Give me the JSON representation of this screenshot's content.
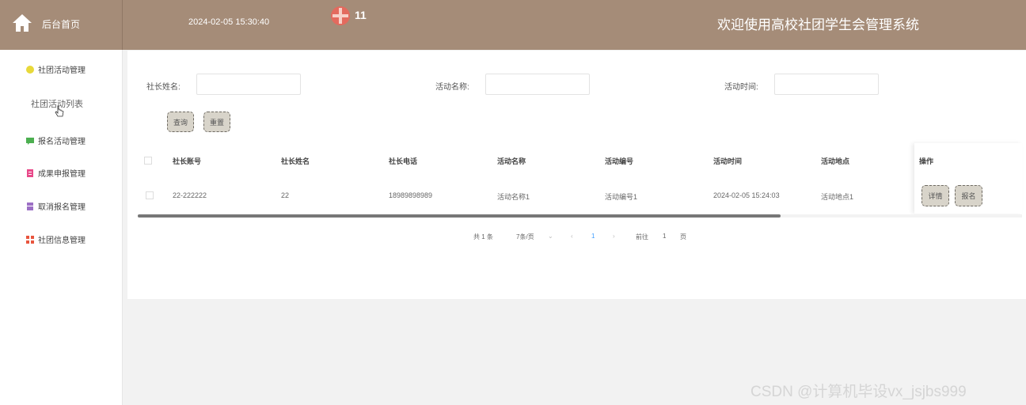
{
  "header": {
    "home_label": "后台首页",
    "datetime": "2024-02-05 15:30:40",
    "badge_count": "11",
    "title": "欢迎使用高校社团学生会管理系统",
    "home_icon": "home-icon",
    "avatar_icon": "avatar-icon"
  },
  "sidebar": {
    "items": [
      {
        "label": "社团活动管理",
        "icon": "circle-icon",
        "color": "#e8d93a"
      },
      {
        "label": "社团活动列表"
      },
      {
        "label": "报名活动管理",
        "icon": "message-icon",
        "color": "#4caf50"
      },
      {
        "label": "成果申报管理",
        "icon": "document-icon",
        "color": "#e84a8a"
      },
      {
        "label": "取消报名管理",
        "icon": "folder-icon",
        "color": "#9c6fc5"
      },
      {
        "label": "社团信息管理",
        "icon": "grid-icon",
        "color": "#e8553e"
      }
    ]
  },
  "filters": {
    "president_name_label": "社长姓名:",
    "activity_name_label": "活动名称:",
    "activity_time_label": "活动时间:",
    "search_button": "查询",
    "reset_button": "重置"
  },
  "table": {
    "columns": [
      "社长账号",
      "社长姓名",
      "社长电话",
      "活动名称",
      "活动编号",
      "活动时间",
      "活动地点",
      "操作"
    ],
    "rows": [
      {
        "account": "22-222222",
        "name": "22",
        "phone": "18989898989",
        "activity_name": "活动名称1",
        "activity_no": "活动编号1",
        "activity_time": "2024-02-05 15:24:03",
        "activity_place": "活动地点1",
        "detail_button": "详情",
        "signup_button": "报名"
      }
    ]
  },
  "pagination": {
    "total": "共 1 条",
    "page_size": "7条/页",
    "prev": "‹",
    "current_page": "1",
    "next": "›",
    "goto_label": "前往",
    "goto_value": "1",
    "page_unit": "页"
  },
  "watermark": "CSDN @计算机毕设vx_jsjbs999",
  "colors": {
    "header_bg": "#a58c78",
    "button_bg": "#d8d4ca",
    "page_bg": "#f2f2f2"
  }
}
